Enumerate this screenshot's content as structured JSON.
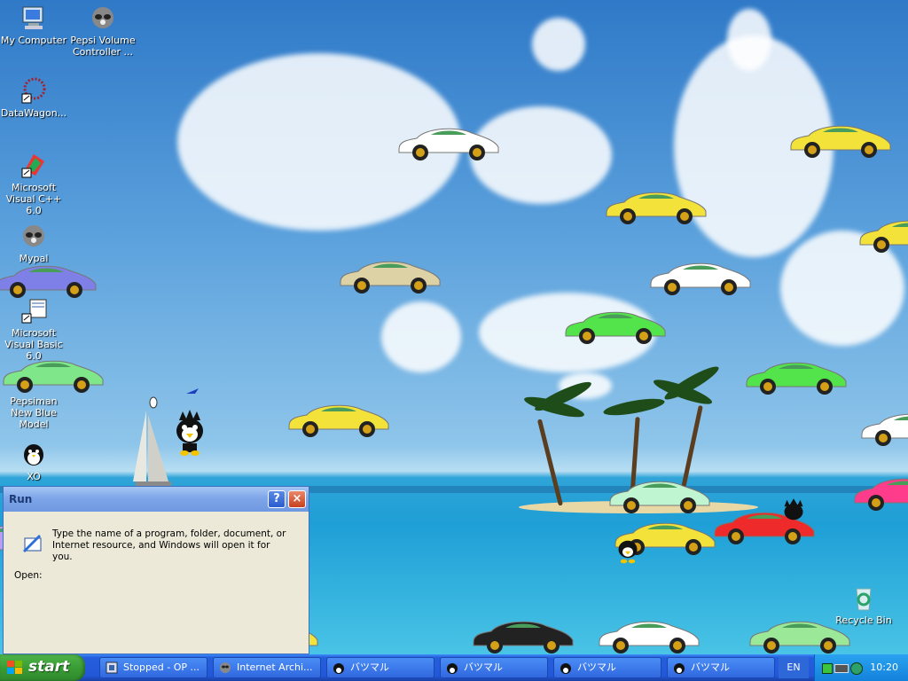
{
  "desktop": {
    "icons": [
      {
        "label": "My Computer",
        "icon": "computer-icon"
      },
      {
        "label": "Pepsi Volume Controller ...",
        "icon": "raccoon-icon"
      },
      {
        "label": "DataWagon...",
        "icon": "datawagon-icon"
      },
      {
        "label": "Microsoft Visual C++ 6.0",
        "icon": "visual-cpp-icon"
      },
      {
        "label": "Mypal",
        "icon": "raccoon-icon"
      },
      {
        "label": "Microsoft Visual Basic 6.0",
        "icon": "visual-basic-icon"
      },
      {
        "label": "Pepsiman New Blue Model",
        "icon": "car-icon"
      },
      {
        "label": "XO",
        "icon": "penguin-icon"
      },
      {
        "label": "Recycle Bin",
        "icon": "recycle-bin-icon"
      }
    ],
    "car_colors": [
      "#ffffff",
      "#f2e23a",
      "#f2e23a",
      "#ddd2a6",
      "#ffffff",
      "#f2e23a",
      "#7f7fe8",
      "#52e44a",
      "#7fe78a",
      "#52e44a",
      "#f2e23a",
      "#ffffff",
      "#bff5d1",
      "#ff3b8c",
      "#ee2a2a",
      "#f2e23a",
      "#f2e23a",
      "#b89df0",
      "#222222",
      "#ffffff",
      "#9ce899"
    ]
  },
  "run_dialog": {
    "title": "Run",
    "help_label": "?",
    "close_label": "×",
    "message": "Type the name of a program, folder, document, or Internet resource, and Windows will open it for you.",
    "open_label": "Open:"
  },
  "taskbar": {
    "start_label": "start",
    "tasks": [
      {
        "label": "Stopped - OP ...",
        "icon": "media-icon"
      },
      {
        "label": "Internet Archi...",
        "icon": "raccoon-icon"
      },
      {
        "label": "バツマル",
        "icon": "penguin-icon"
      },
      {
        "label": "バツマル",
        "icon": "penguin-icon"
      },
      {
        "label": "バツマル",
        "icon": "penguin-icon"
      },
      {
        "label": "バツマル",
        "icon": "penguin-icon"
      }
    ],
    "language": "EN",
    "clock": "10:20"
  }
}
